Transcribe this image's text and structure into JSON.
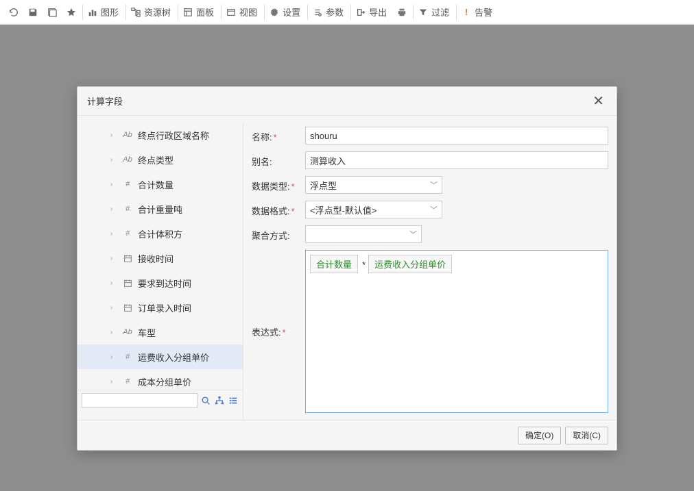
{
  "toolbar": {
    "items": [
      {
        "icon": "refresh",
        "label": ""
      },
      {
        "icon": "save",
        "label": ""
      },
      {
        "icon": "saveas",
        "label": ""
      },
      {
        "icon": "star",
        "label": ""
      },
      {
        "icon": "chart",
        "label": "图形"
      },
      {
        "icon": "tree",
        "label": "资源树"
      },
      {
        "icon": "panel",
        "label": "面板"
      },
      {
        "icon": "view",
        "label": "视图"
      },
      {
        "icon": "gear",
        "label": "设置"
      },
      {
        "icon": "params",
        "label": "参数"
      },
      {
        "icon": "export",
        "label": "导出"
      },
      {
        "icon": "print",
        "label": ""
      },
      {
        "icon": "filter",
        "label": "过滤"
      },
      {
        "icon": "alert",
        "label": "告警"
      }
    ]
  },
  "modal": {
    "title": "计算字段",
    "fields": [
      {
        "type": "Ab",
        "label": "终点行政区域名称"
      },
      {
        "type": "Ab",
        "label": "终点类型"
      },
      {
        "type": "#",
        "label": "合计数量"
      },
      {
        "type": "#",
        "label": "合计重量吨"
      },
      {
        "type": "#",
        "label": "合计体积方"
      },
      {
        "type": "date",
        "label": "接收时间"
      },
      {
        "type": "date",
        "label": "要求到达时间"
      },
      {
        "type": "date",
        "label": "订单录入时间"
      },
      {
        "type": "Ab",
        "label": "车型"
      },
      {
        "type": "#",
        "label": "运费收入分组单价",
        "selected": true
      },
      {
        "type": "#",
        "label": "成本分组单价"
      }
    ],
    "form": {
      "name_label": "名称:",
      "name_value": "shouru",
      "alias_label": "别名:",
      "alias_value": "测算收入",
      "dtype_label": "数据类型:",
      "dtype_value": "浮点型",
      "dformat_label": "数据格式:",
      "dformat_value": "<浮点型-默认值>",
      "agg_label": "聚合方式:",
      "agg_value": "",
      "expr_label": "表达式:",
      "expr_tokens": [
        "合计数量",
        "*",
        "运费收入分组单价"
      ]
    },
    "buttons": {
      "ok": "确定(O)",
      "cancel": "取消(C)"
    }
  }
}
